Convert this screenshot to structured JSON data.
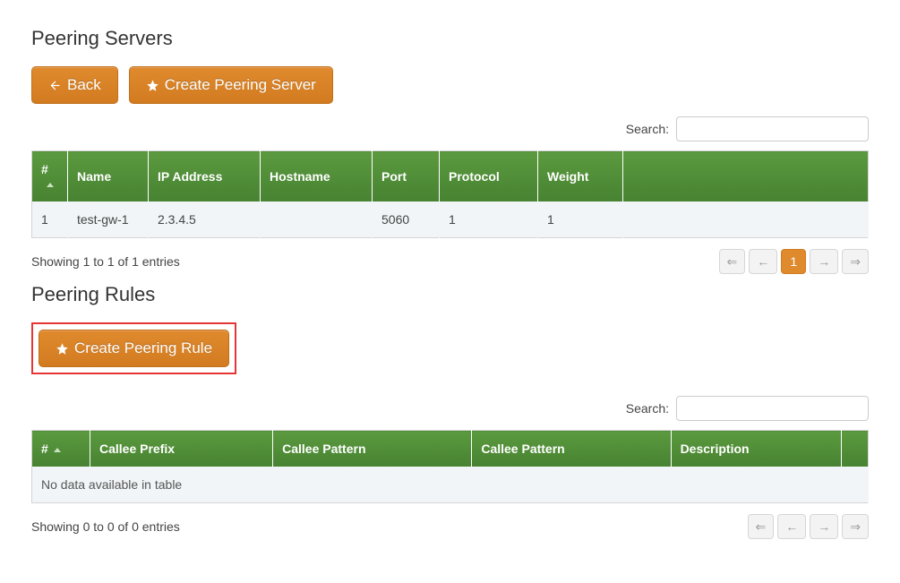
{
  "sections": {
    "servers": {
      "title": "Peering Servers",
      "back_label": "Back",
      "create_label": "Create Peering Server",
      "search_label": "Search:",
      "columns": {
        "id": "#",
        "name": "Name",
        "ip": "IP Address",
        "hostname": "Hostname",
        "port": "Port",
        "protocol": "Protocol",
        "weight": "Weight"
      },
      "rows": [
        {
          "id": "1",
          "name": "test-gw-1",
          "ip": "2.3.4.5",
          "hostname": "",
          "port": "5060",
          "protocol": "1",
          "weight": "1"
        }
      ],
      "info": "Showing 1 to 1 of 1 entries",
      "pager": {
        "first": "⇐",
        "prev": "←",
        "page": "1",
        "next": "→",
        "last": "⇒"
      }
    },
    "rules": {
      "title": "Peering Rules",
      "create_label": "Create Peering Rule",
      "search_label": "Search:",
      "columns": {
        "id": "#",
        "prefix": "Callee Prefix",
        "pattern1": "Callee Pattern",
        "pattern2": "Callee Pattern",
        "desc": "Description"
      },
      "empty": "No data available in table",
      "info": "Showing 0 to 0 of 0 entries",
      "pager": {
        "first": "⇐",
        "prev": "←",
        "next": "→",
        "last": "⇒"
      }
    }
  }
}
